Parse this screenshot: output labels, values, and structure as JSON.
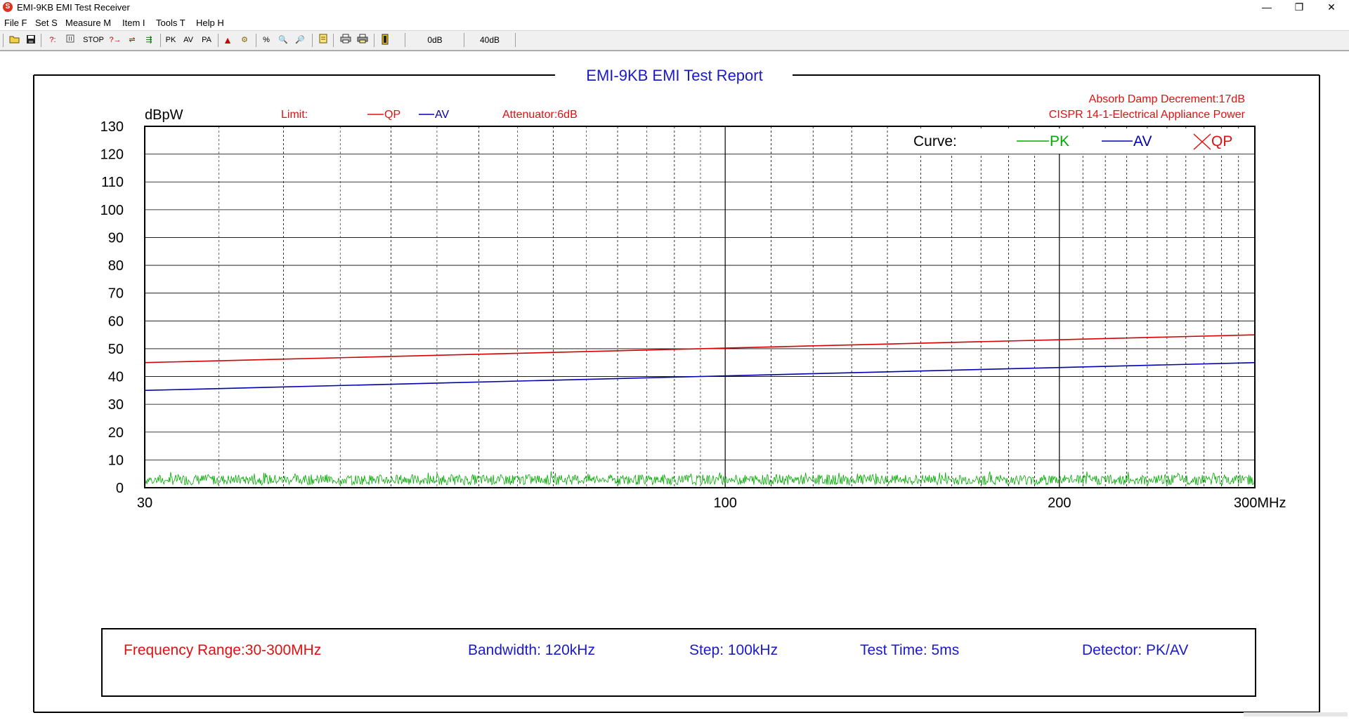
{
  "window": {
    "title": "EMI-9KB EMI Test Receiver",
    "controls": [
      "—",
      "❐",
      "✕"
    ]
  },
  "menu": [
    {
      "label": "File F"
    },
    {
      "label": "Set S"
    },
    {
      "label": "Measure M"
    },
    {
      "label": "Item I"
    },
    {
      "label": "Tools T"
    },
    {
      "label": "Help H"
    }
  ],
  "toolbar": {
    "stop_label": "STOP",
    "pk_label": "PK",
    "av_label": "AV",
    "pa_label": "PA",
    "attn1": "0dB",
    "attn2": "40dB"
  },
  "report": {
    "title": "EMI-9KB EMI Test Report",
    "limit_label": "Limit:",
    "limit_qp": "QP",
    "limit_av": "AV",
    "attenuator": "Attenuator:6dB",
    "damp": "Absorb Damp Decrement:17dB",
    "standard": "CISPR 14-1-Electrical Appliance Power",
    "curve_label": "Curve:",
    "curve_pk": "PK",
    "curve_av": "AV",
    "curve_qp": "QP",
    "info": {
      "freq_range": "Frequency Range:30-300MHz",
      "bandwidth": "Bandwidth: 120kHz",
      "step": "Step: 100kHz",
      "test_time": "Test Time: 5ms",
      "detector": "Detector: PK/AV"
    }
  },
  "chart_data": {
    "type": "line",
    "ylabel": "dBpW",
    "xlim": [
      30,
      300
    ],
    "ylim": [
      0,
      130
    ],
    "x_scale": "log",
    "y_ticks": [
      0,
      10,
      20,
      30,
      40,
      50,
      60,
      70,
      80,
      90,
      100,
      110,
      120,
      130
    ],
    "x_ticks": [
      {
        "value": 30,
        "label": "30"
      },
      {
        "value": 100,
        "label": "100"
      },
      {
        "value": 200,
        "label": "200"
      },
      {
        "value": 300,
        "label": "300MHz"
      }
    ],
    "grid": true,
    "series": [
      {
        "name": "QP",
        "role": "limit",
        "color": "#d40000",
        "x": [
          30,
          300
        ],
        "y": [
          45,
          55
        ]
      },
      {
        "name": "AV",
        "role": "limit",
        "color": "#0000b0",
        "x": [
          30,
          300
        ],
        "y": [
          35,
          45
        ]
      },
      {
        "name": "PK",
        "role": "curve",
        "color": "#00aa00",
        "noise_level": 3,
        "noise_range": [
          1,
          6
        ]
      }
    ]
  },
  "colors": {
    "title_blue": "#1a1acc",
    "limit_red": "#e01010",
    "pk_green": "#00aa00",
    "av_blue": "#0000b0"
  }
}
